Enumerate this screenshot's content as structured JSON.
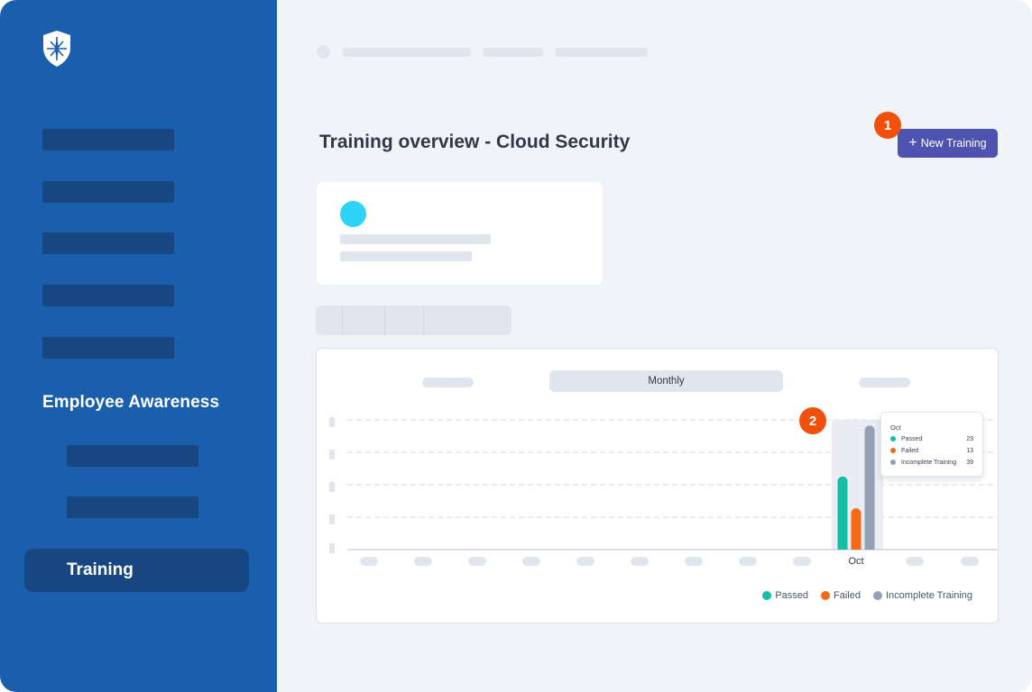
{
  "main": {
    "page_title": "Training overview - Cloud Security",
    "new_button_label": "New Training",
    "new_button_icon": "plus-icon"
  },
  "sidebar": {
    "logo_icon": "shield-compass-icon",
    "section_label": "Employee Awareness",
    "active_item": "Training"
  },
  "markers": [
    "1",
    "2"
  ],
  "chart": {
    "active_tab": "Monthly",
    "tooltip": {
      "title": "Oct",
      "rows": [
        {
          "label": "Passed",
          "value": "23"
        },
        {
          "label": "Failed",
          "value": "13"
        },
        {
          "label": "Incomplete Training",
          "value": "39"
        }
      ]
    },
    "legend": [
      "Passed",
      "Failed",
      "Incomplete Training"
    ],
    "x_label": "Oct"
  },
  "colors": {
    "sidebar": "#1a5fac",
    "accent": "#4e52b0",
    "marker": "#f0500c",
    "passed": "#14bfa6",
    "failed": "#f56b14",
    "incomplete": "#94a0b4"
  },
  "chart_data": {
    "type": "bar",
    "categories": [
      "Oct"
    ],
    "series": [
      {
        "name": "Passed",
        "values": [
          23
        ]
      },
      {
        "name": "Failed",
        "values": [
          13
        ]
      },
      {
        "name": "Incomplete Training",
        "values": [
          39
        ]
      }
    ],
    "ylim": [
      0,
      40
    ],
    "grid": true,
    "legend_position": "bottom-right"
  }
}
